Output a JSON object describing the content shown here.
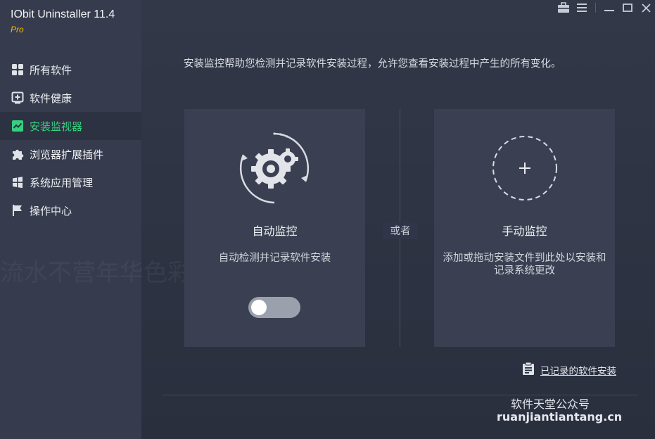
{
  "app": {
    "title": "IObit Uninstaller 11.4",
    "edition": "Pro"
  },
  "sidebar": {
    "items": [
      {
        "label": "所有软件",
        "icon": "grid-icon",
        "active": false
      },
      {
        "label": "软件健康",
        "icon": "health-plus-icon",
        "active": false
      },
      {
        "label": "安装监视器",
        "icon": "monitor-chart-icon",
        "active": true
      },
      {
        "label": "浏览器扩展插件",
        "icon": "puzzle-icon",
        "active": false
      },
      {
        "label": "系统应用管理",
        "icon": "windows-icon",
        "active": false
      },
      {
        "label": "操作中心",
        "icon": "flag-icon",
        "active": false
      }
    ]
  },
  "titlebar": {
    "icons": [
      "toolbox-icon",
      "menu-icon",
      "minimize-icon",
      "maximize-icon",
      "close-icon"
    ]
  },
  "main": {
    "intro": "安装监控帮助您检测并记录软件安装过程，允许您查看安装过程中产生的所有变化。",
    "auto": {
      "title": "自动监控",
      "desc": "自动检测并记录软件安装",
      "icon": "gear-sync-icon",
      "toggle_on": false
    },
    "or_label": "或者",
    "manual": {
      "title": "手动监控",
      "desc": "添加或拖动安装文件到此处以安装和记录系统更改",
      "icon": "plus-circle-icon"
    },
    "history_link": "已记录的软件安装"
  },
  "watermark": {
    "line1": "软件天堂公众号",
    "line2": "ruanjiantiantang.cn",
    "bg": "流水不营年华色彩"
  },
  "colors": {
    "accent_green": "#35d07f",
    "pro_gold": "#f5b800",
    "sidebar_bg": "#363c4d",
    "main_bg": "#2b3040"
  }
}
